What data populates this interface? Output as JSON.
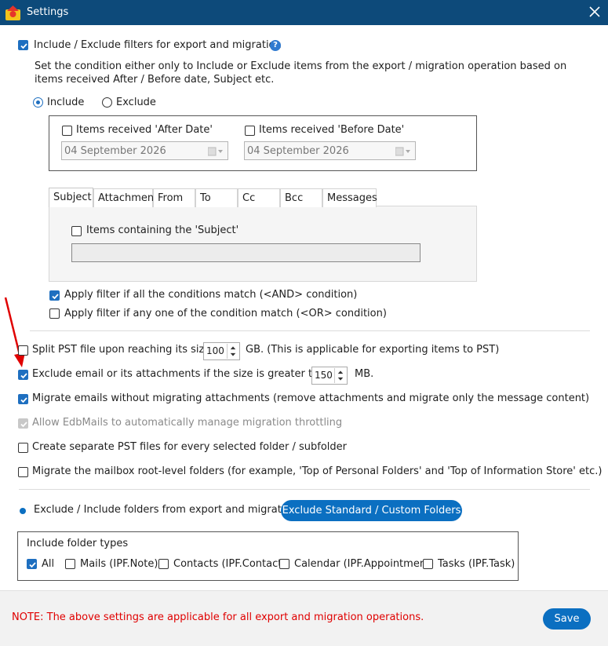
{
  "window": {
    "title": "Settings"
  },
  "filters": {
    "enable_label": "Include / Exclude filters for export and migration",
    "description": "Set the condition either only to Include or Exclude items from the export / migration operation based on items received After / Before date, Subject etc.",
    "mode": {
      "include_label": "Include",
      "exclude_label": "Exclude",
      "selected": "Include"
    },
    "after_date": {
      "label": "Items received 'After Date'",
      "value": "04 September 2026",
      "checked": false
    },
    "before_date": {
      "label": "Items received 'Before Date'",
      "value": "04 September 2026",
      "checked": false
    },
    "tabs": [
      "Subject",
      "Attachment",
      "From",
      "To",
      "Cc",
      "Bcc",
      "Messages"
    ],
    "active_tab": "Subject",
    "subject": {
      "label": "Items containing the 'Subject'",
      "checked": false,
      "value": ""
    },
    "and_label": "Apply filter if all the conditions match (<AND> condition)",
    "or_label": "Apply filter if any one of the condition match (<OR> condition)"
  },
  "options": {
    "split_pst": {
      "label_before": "Split PST file upon reaching its size",
      "value": "100",
      "label_after": "GB. (This is applicable for exporting items to PST)",
      "checked": false
    },
    "exclude_size": {
      "label_before": "Exclude email or its attachments if the size is greater than",
      "value": "150",
      "label_after": "MB.",
      "checked": true
    },
    "no_attachments": {
      "label": "Migrate emails without migrating attachments (remove attachments and migrate only the message content)",
      "checked": true
    },
    "throttling": {
      "label": "Allow EdbMails to automatically manage migration throttling",
      "checked": true,
      "disabled": true
    },
    "separate_pst": {
      "label": "Create separate PST files for every selected folder / subfolder",
      "checked": false
    },
    "root_folders": {
      "label": "Migrate the mailbox root-level folders (for example, 'Top of Personal Folders' and 'Top of Information Store' etc.)",
      "checked": false
    }
  },
  "folders": {
    "label": "Exclude / Include folders from export and migration",
    "button_label": "Exclude Standard / Custom Folders",
    "types_title": "Include folder types",
    "types": [
      {
        "label": "All",
        "checked": true
      },
      {
        "label": "Mails (IPF.Note)",
        "checked": false
      },
      {
        "label": "Contacts (IPF.Contact)",
        "checked": false
      },
      {
        "label": "Calendar (IPF.Appointment)",
        "checked": false
      },
      {
        "label": "Tasks (IPF.Task)",
        "checked": false
      }
    ]
  },
  "footer": {
    "note": "NOTE: The above settings are applicable for all export and migration operations.",
    "save_label": "Save"
  },
  "colors": {
    "titlebar": "#0d4a7a",
    "accent": "#0b6fc1",
    "note": "#e00000",
    "annotation_arrow": "#e00000"
  }
}
